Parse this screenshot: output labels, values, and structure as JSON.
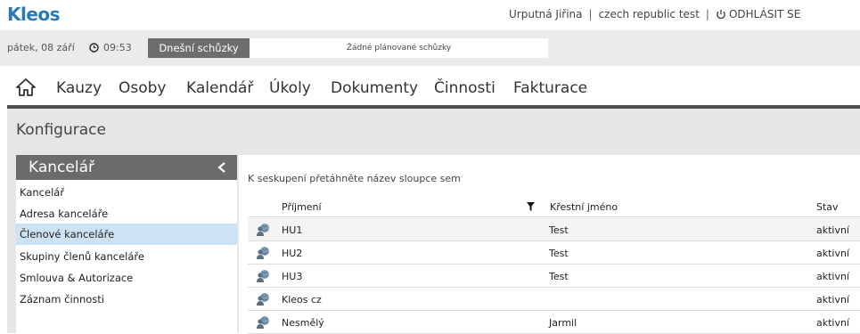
{
  "app": {
    "logo": "Kleos"
  },
  "user": {
    "name": "Urputná Jiřina",
    "company": "czech republic test",
    "logout_label": "ODHLÁSIT SE"
  },
  "datebar": {
    "date": "pátek, 08 září",
    "time": "09:53",
    "meetings_label": "Dnešní schůzky",
    "meetings_text": "Žádné plánované schůzky"
  },
  "nav": {
    "items": [
      "Kauzy",
      "Osoby",
      "Kalendář",
      "Úkoly",
      "Dokumenty",
      "Činnosti",
      "Fakturace"
    ]
  },
  "config": {
    "title": "Konfigurace"
  },
  "sidebar": {
    "header": "Kancelář",
    "items": [
      {
        "label": "Kancelář"
      },
      {
        "label": "Adresa kanceláře"
      },
      {
        "label": "Členové kanceláře"
      },
      {
        "label": "Skupiny členů kanceláře"
      },
      {
        "label": "Smlouva & Autorizace"
      },
      {
        "label": "Záznam činnosti"
      }
    ],
    "active_index": 2
  },
  "grid": {
    "group_hint": "K seskupení přetáhněte název sloupce sem",
    "columns": [
      "Příjmení",
      "Křestní jméno",
      "Stav"
    ],
    "rows": [
      {
        "surname": "HU1",
        "first": "Test",
        "status": "aktivní"
      },
      {
        "surname": "HU2",
        "first": "Test",
        "status": "aktivní"
      },
      {
        "surname": "HU3",
        "first": "Test",
        "status": "aktivní"
      },
      {
        "surname": "Kleos cz",
        "first": "",
        "status": "aktivní"
      },
      {
        "surname": "Nesmělý",
        "first": "Jarmil",
        "status": "aktivní"
      }
    ]
  },
  "colors": {
    "brand": "#2a7ab0",
    "active_item": "#cde3f3",
    "header_dark": "#6b6b6b"
  }
}
